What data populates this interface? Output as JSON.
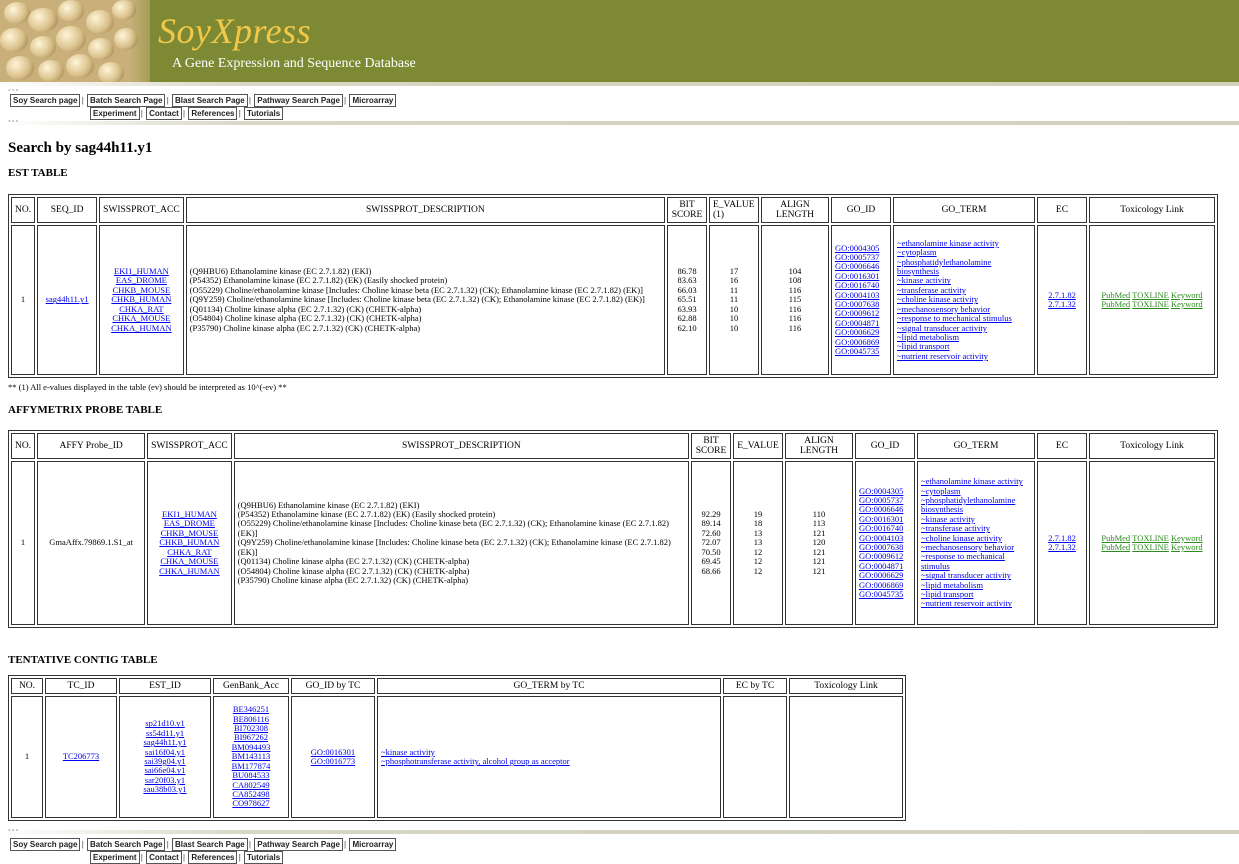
{
  "header": {
    "title": "SoyXpress",
    "subtitle": "A Gene Expression and Sequence Database"
  },
  "nav": {
    "soy_search": "Soy Search page",
    "batch_search": "Batch Search Page",
    "blast_search": "Blast Search Page",
    "pathway_search": "Pathway Search Page",
    "microarray": "Microarray",
    "experiment": "Experiment",
    "contact": "Contact",
    "references": "References",
    "tutorials": "Tutorials"
  },
  "page_title": "Search by sag44h11.y1",
  "est": {
    "heading": "EST TABLE",
    "headers": [
      "NO.",
      "SEQ_ID",
      "SWISSPROT_ACC",
      "SWISSPROT_DESCRIPTION",
      "BIT SCORE",
      "E_VALUE (1)",
      "ALIGN LENGTH",
      "GO_ID",
      "GO_TERM",
      "EC",
      "Toxicology Link"
    ],
    "no": "1",
    "seq_id": "sag44h11.y1",
    "acc": [
      "EKI1_HUMAN",
      "EAS_DROME",
      "CHKB_MOUSE",
      "CHKB_HUMAN",
      "CHKA_RAT",
      "CHKA_MOUSE",
      "CHKA_HUMAN"
    ],
    "desc": [
      "(Q9HBU6) Ethanolamine kinase (EC 2.7.1.82) (EKI)",
      "(P54352) Ethanolamine kinase (EC 2.7.1.82) (EK) (Easily shocked protein)",
      "(O55229) Choline/ethanolamine kinase [Includes: Choline kinase beta (EC 2.7.1.32) (CK); Ethanolamine kinase (EC 2.7.1.82) (EK)]",
      "(Q9Y259) Choline/ethanolamine kinase [Includes: Choline kinase beta (EC 2.7.1.32) (CK); Ethanolamine kinase (EC 2.7.1.82) (EK)]",
      "(Q01134) Choline kinase alpha (EC 2.7.1.32) (CK) (CHETK-alpha)",
      "(O54804) Choline kinase alpha (EC 2.7.1.32) (CK) (CHETK-alpha)",
      "(P35790) Choline kinase alpha (EC 2.7.1.32) (CK) (CHETK-alpha)"
    ],
    "bit": [
      "86.78",
      "83.63",
      "66.03",
      "65.51",
      "63.93",
      "62.88",
      "62.10"
    ],
    "evalue": [
      "17",
      "16",
      "11",
      "11",
      "10",
      "10",
      "10"
    ],
    "align": [
      "104",
      "108",
      "116",
      "115",
      "116",
      "116",
      "116"
    ],
    "go_id": [
      "GO:0004305",
      "GO:0005737",
      "GO:0006646",
      "GO:0016301",
      "GO:0016740",
      "GO:0004103",
      "GO:0007638",
      "GO:0009612",
      "GO:0004871",
      "GO:0006629",
      "GO:0006869",
      "GO:0045735"
    ],
    "go_term": [
      "~ethanolamine kinase activity",
      "~cytoplasm",
      "~phosphatidylethanolamine biosynthesis",
      "~kinase activity",
      "~transferase activity",
      "~choline kinase activity",
      "~mechanosensory behavior",
      "~response to mechanical stimulus",
      "~signal transducer activity",
      "~lipid metabolism",
      "~lipid transport",
      "~nutrient reservoir activity"
    ],
    "ec": [
      "2.7.1.82",
      "2.7.1.32"
    ],
    "tox": [
      "PubMed",
      "TOXLINE",
      "Keyword"
    ]
  },
  "footnote": "** (1) All e-values displayed in the table (ev) should be interpreted as 10^(-ev) **",
  "affy": {
    "heading": "AFFYMETRIX PROBE TABLE",
    "headers": [
      "NO.",
      "AFFY Probe_ID",
      "SWISSPROT_ACC",
      "SWISSPROT_DESCRIPTION",
      "BIT SCORE",
      "E_VALUE",
      "ALIGN LENGTH",
      "GO_ID",
      "GO_TERM",
      "EC",
      "Toxicology Link"
    ],
    "no": "1",
    "probe_id": "GmaAffx.79869.1.S1_at",
    "acc": [
      "EKI1_HUMAN",
      "EAS_DROME",
      "CHKB_MOUSE",
      "CHKB_HUMAN",
      "CHKA_RAT",
      "CHKA_MOUSE",
      "CHKA_HUMAN"
    ],
    "desc": [
      "(Q9HBU6) Ethanolamine kinase (EC 2.7.1.82) (EKI)",
      "(P54352) Ethanolamine kinase (EC 2.7.1.82) (EK) (Easily shocked protein)",
      "(O55229) Choline/ethanolamine kinase [Includes: Choline kinase beta (EC 2.7.1.32) (CK); Ethanolamine kinase (EC 2.7.1.82) (EK)]",
      "(Q9Y259) Choline/ethanolamine kinase [Includes: Choline kinase beta (EC 2.7.1.32) (CK); Ethanolamine kinase (EC 2.7.1.82) (EK)]",
      "(Q01134) Choline kinase alpha (EC 2.7.1.32) (CK) (CHETK-alpha)",
      "(O54804) Choline kinase alpha (EC 2.7.1.32) (CK) (CHETK-alpha)",
      "(P35790) Choline kinase alpha (EC 2.7.1.32) (CK) (CHETK-alpha)"
    ],
    "bit": [
      "92.29",
      "89.14",
      "72.60",
      "72.07",
      "70.50",
      "69.45",
      "68.66"
    ],
    "evalue": [
      "19",
      "18",
      "13",
      "13",
      "12",
      "12",
      "12"
    ],
    "align": [
      "110",
      "113",
      "121",
      "120",
      "121",
      "121",
      "121"
    ],
    "go_id": [
      "GO:0004305",
      "GO:0005737",
      "GO:0006646",
      "GO:0016301",
      "GO:0016740",
      "GO:0004103",
      "GO:0007638",
      "GO:0009612",
      "GO:0004871",
      "GO:0006629",
      "GO:0006869",
      "GO:0045735"
    ],
    "go_term": [
      "~ethanolamine kinase activity",
      "~cytoplasm",
      "~phosphatidylethanolamine biosynthesis",
      "~kinase activity",
      "~transferase activity",
      "~choline kinase activity",
      "~mechanosensory behavior",
      "~response to mechanical stimulus",
      "~signal transducer activity",
      "~lipid metabolism",
      "~lipid transport",
      "~nutrient reservoir activity"
    ],
    "ec": [
      "2.7.1.82",
      "2.7.1.32"
    ],
    "tox": [
      "PubMed",
      "TOXLINE",
      "Keyword"
    ]
  },
  "tc": {
    "heading": "TENTATIVE CONTIG TABLE",
    "headers": [
      "NO.",
      "TC_ID",
      "EST_ID",
      "GenBank_Acc",
      "GO_ID by TC",
      "GO_TERM by TC",
      "EC by TC",
      "Toxicology Link"
    ],
    "no": "1",
    "tc_id": "TC206773",
    "est_ids": [
      "sp21d10.y1",
      "ss54d11.y1",
      "sag44h11.y1",
      "sai16f04.y1",
      "sai39g04.y1",
      "sai66e04.y1",
      "sar20f03.y1",
      "sau38b03.y1"
    ],
    "genbank": [
      "BE346251",
      "BE806116",
      "BI702308",
      "BI967262",
      "BM094493",
      "BM143113",
      "BM177874",
      "BU084533",
      "CA802549",
      "CA852498",
      "CO978627"
    ],
    "go_ids": [
      "GO:0016301",
      "GO:0016773"
    ],
    "go_terms": [
      "~kinase activity",
      "~phosphotransferase activity, alcohol group as acceptor"
    ]
  }
}
